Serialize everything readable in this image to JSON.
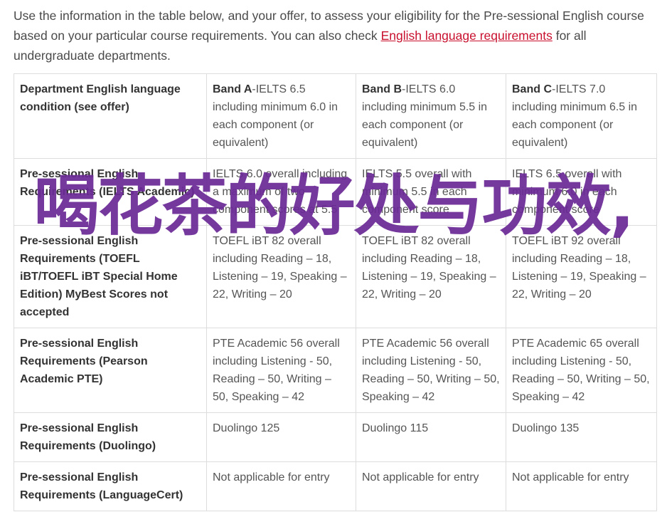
{
  "intro": {
    "text_before": "Use the information in the table below, and your offer, to assess your eligibility for the Pre-sessional English course based on your particular course requirements. You can also check ",
    "link": "English language requirements",
    "text_after": " for all undergraduate departments."
  },
  "table": {
    "header": {
      "condition": "Department English language condition (see offer)",
      "bands": [
        {
          "name": "Band A",
          "desc": "-IELTS 6.5 including minimum 6.0 in each component (or equivalent)"
        },
        {
          "name": "Band B",
          "desc": "-IELTS 6.0 including minimum 5.5 in each component (or equivalent)"
        },
        {
          "name": "Band C",
          "desc": "-IELTS 7.0 including minimum 6.5 in each component (or equivalent)"
        }
      ]
    },
    "rows": [
      {
        "label": "Pre-sessional English Requirements (IELTS Academic)",
        "values": [
          "IELTS 6.0 overall including a maximum of two component scores at 5.5",
          "IELTS 5.5 overall with minimum 5.5 in each component score",
          "IELTS 6.5 overall with minimum 6.0 in each component score"
        ]
      },
      {
        "label": "Pre-sessional English Requirements (TOEFL iBT/TOEFL iBT Special Home Edition) MyBest Scores not accepted",
        "values": [
          "TOEFL iBT 82 overall including Reading – 18, Listening – 19, Speaking – 22, Writing – 20",
          "TOEFL iBT 82 overall including Reading – 18, Listening – 19, Speaking – 22, Writing – 20",
          "TOEFL iBT 92 overall including Reading – 18, Listening – 19, Speaking – 22, Writing – 20"
        ]
      },
      {
        "label": "Pre-sessional English Requirements (Pearson Academic PTE)",
        "values": [
          "PTE Academic 56 overall including Listening - 50, Reading – 50, Writing – 50, Speaking – 42",
          "PTE Academic 56 overall including Listening - 50, Reading – 50, Writing – 50, Speaking – 42",
          "PTE Academic 65 overall including Listening - 50, Reading – 50, Writing – 50, Speaking – 42"
        ]
      },
      {
        "label": "Pre-sessional English Requirements (Duolingo)",
        "values": [
          "Duolingo 125",
          "Duolingo 115",
          "Duolingo 135"
        ]
      },
      {
        "label": "Pre-sessional English Requirements (LanguageCert)",
        "values": [
          "Not applicable for entry",
          "Not applicable for entry",
          "Not applicable for entry"
        ]
      }
    ]
  },
  "overlay_text": "喝花茶的好处与功效,",
  "colors": {
    "link": "#c8102e",
    "overlay": "#6b2a96",
    "border": "#dddddd"
  }
}
